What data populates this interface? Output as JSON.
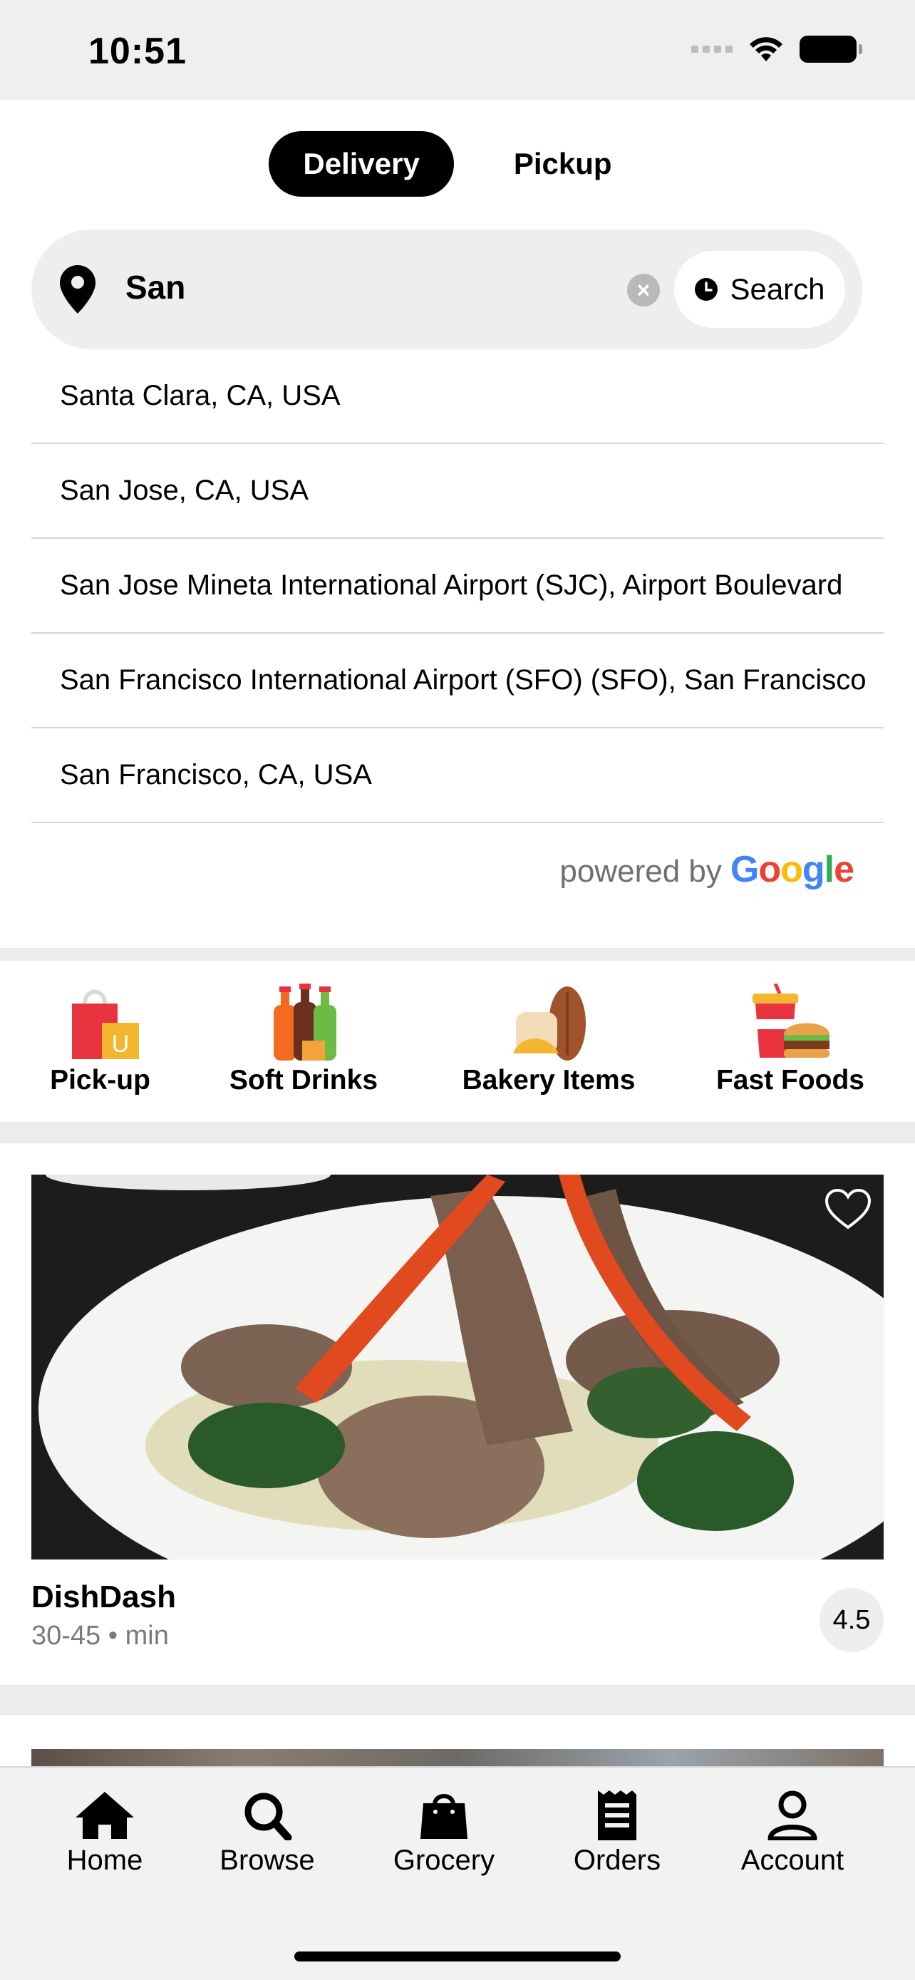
{
  "status_bar": {
    "time": "10:51"
  },
  "mode_toggle": {
    "options": [
      "Delivery",
      "Pickup"
    ],
    "selected": "Delivery"
  },
  "search": {
    "value": "San",
    "button_label": "Search"
  },
  "suggestions": [
    "Santa Clara, CA, USA",
    "San Jose, CA, USA",
    "San Jose Mineta International Airport (SJC), Airport Boulevard",
    "San Francisco International Airport (SFO) (SFO), San Francisco",
    "San Francisco, CA, USA"
  ],
  "attribution": {
    "text": "powered by",
    "brand": "Google"
  },
  "categories": [
    {
      "label": "Pick-up",
      "icon": "shopping-bag-icon"
    },
    {
      "label": "Soft Drinks",
      "icon": "soda-bottles-icon"
    },
    {
      "label": "Bakery Items",
      "icon": "bread-icon"
    },
    {
      "label": "Fast Foods",
      "icon": "burger-drink-icon"
    }
  ],
  "restaurant": {
    "name": "DishDash",
    "time": "30-45 • min",
    "rating": "4.5",
    "favorite": false
  },
  "tab_bar": [
    {
      "label": "Home",
      "icon": "home-icon"
    },
    {
      "label": "Browse",
      "icon": "search-icon"
    },
    {
      "label": "Grocery",
      "icon": "grocery-bag-icon"
    },
    {
      "label": "Orders",
      "icon": "receipt-icon"
    },
    {
      "label": "Account",
      "icon": "person-icon"
    }
  ],
  "colors": {
    "accent": "#000000",
    "background": "#ffffff",
    "band": "#ececec",
    "muted_text": "#7a7a7a"
  }
}
